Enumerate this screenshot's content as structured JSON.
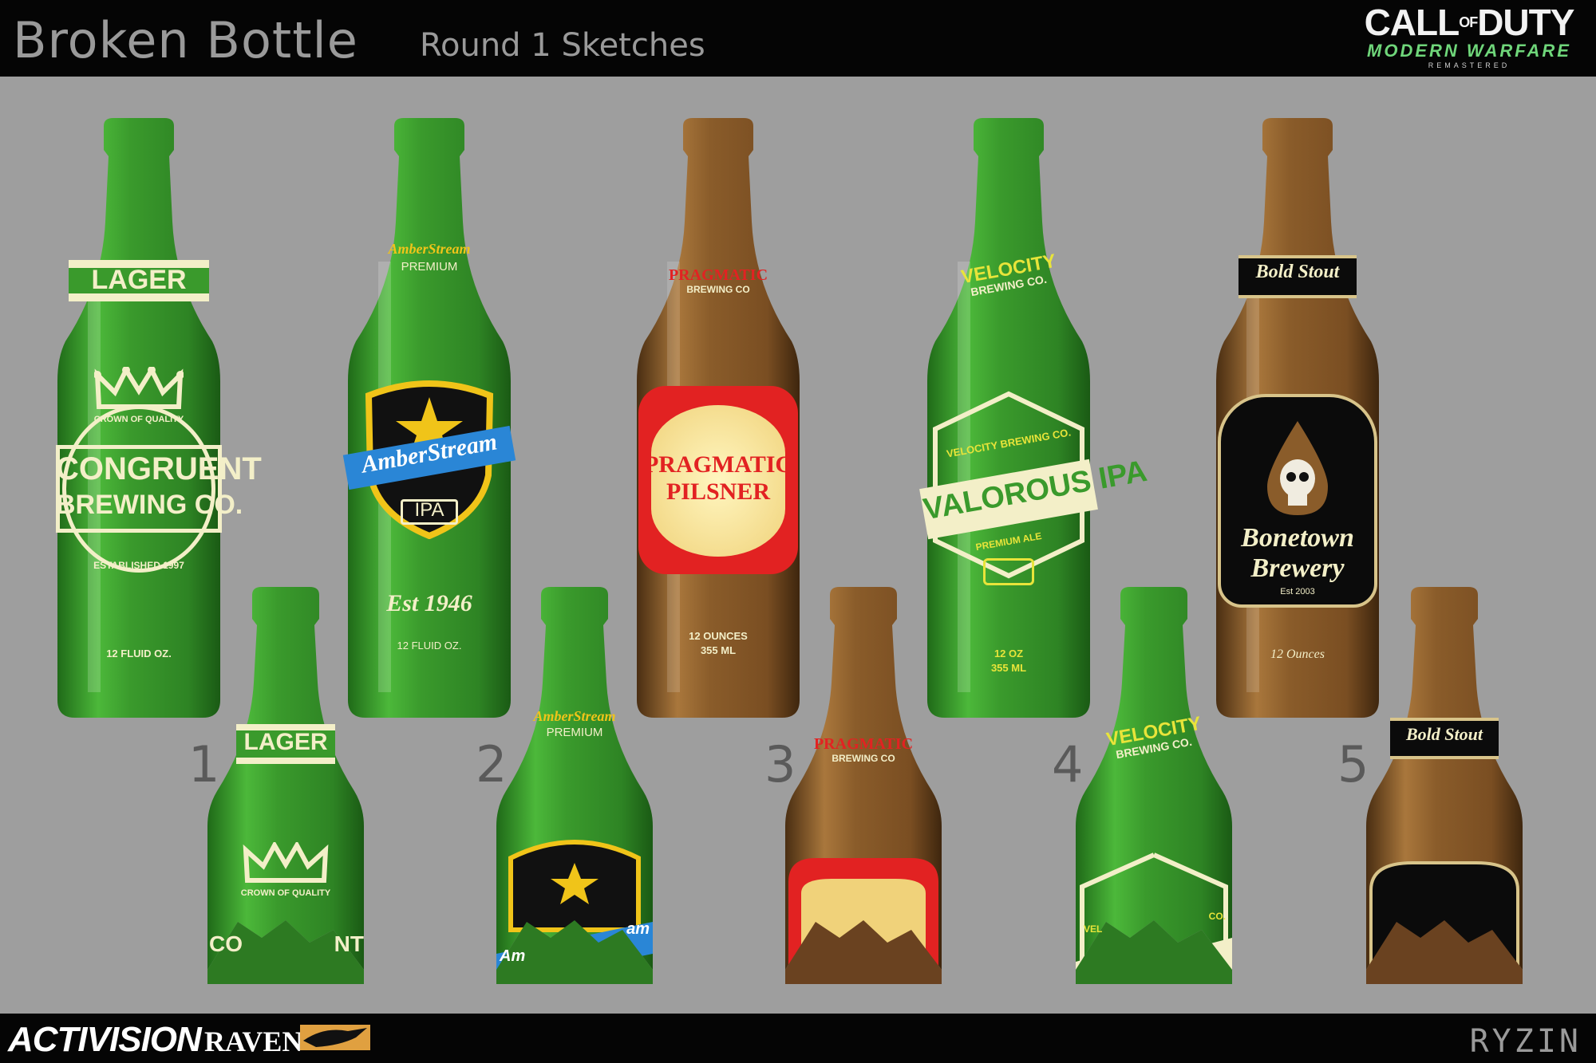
{
  "header": {
    "title": "Broken Bottle",
    "subtitle": "Round 1 Sketches",
    "logo": {
      "main": "CALL",
      "of": "OF",
      "duty": "DUTY",
      "line2": "MODERN WARFARE",
      "line3": "REMASTERED"
    }
  },
  "footer": {
    "activision": "ACTIVISION",
    "raven": "RAVEN",
    "artist": "RYZIN"
  },
  "numbers": [
    "1",
    "2",
    "3",
    "4",
    "5"
  ],
  "bottles": [
    {
      "id": "congruent",
      "glass": "green",
      "neck": "LAGER",
      "tag": "CROWN OF QUALITY",
      "brand1": "CONGRUENT",
      "brand2": "BREWING CO.",
      "est": "ESTABLISHED 1997",
      "volume": "12 FLUID OZ."
    },
    {
      "id": "amberstream",
      "glass": "green",
      "neck1": "AmberStream",
      "neck2": "PREMIUM",
      "banner": "AmberStream",
      "style": "IPA",
      "est": "Est 1946",
      "volume": "12 FLUID OZ."
    },
    {
      "id": "pragmatic",
      "glass": "brown",
      "neck1": "PRAGMATIC",
      "neck2": "BREWING CO",
      "main1": "PRAGMATIC",
      "main2": "PILSNER",
      "volume1": "12 OUNCES",
      "volume2": "355 ML"
    },
    {
      "id": "velocity",
      "glass": "green",
      "neck1": "VELOCITY",
      "neck2": "BREWING CO.",
      "arc": "VELOCITY BREWING CO.",
      "main": "VALOROUS IPA",
      "style": "PREMIUM ALE",
      "volume1": "12 OZ",
      "volume2": "355 ML"
    },
    {
      "id": "bonetown",
      "glass": "brown",
      "neck": "Bold Stout",
      "brand1": "Bonetown",
      "brand2": "Brewery",
      "est": "Est 2003",
      "volume": "12 Ounces"
    }
  ],
  "colors": {
    "green_glass": "#3a9a2c",
    "brown_glass": "#8a5c2a",
    "label_cream": "#f3efc8",
    "amber_yellow": "#f0c419",
    "amber_blue": "#2a86d6",
    "pragmatic_red": "#e22222",
    "velocity_yellow": "#e8e43a",
    "bone_black": "#0b0b0b"
  },
  "broken_labels": {
    "congruent": {
      "neck": "LAGER",
      "tag": "CROWN OF QUALITY",
      "frag1": "CO",
      "frag2": "NT"
    },
    "amberstream": {
      "neck1": "AmberStream",
      "neck2": "PREMIUM",
      "frag1": "Am",
      "frag2": "am"
    },
    "pragmatic": {
      "neck1": "PRAGMATIC",
      "neck2": "BREWING CO"
    },
    "velocity": {
      "neck1": "VELOCITY",
      "neck2": "BREWING CO.",
      "frag1": "VEL",
      "frag2": "CO."
    },
    "bonetown": {
      "neck": "Bold Stout"
    }
  }
}
